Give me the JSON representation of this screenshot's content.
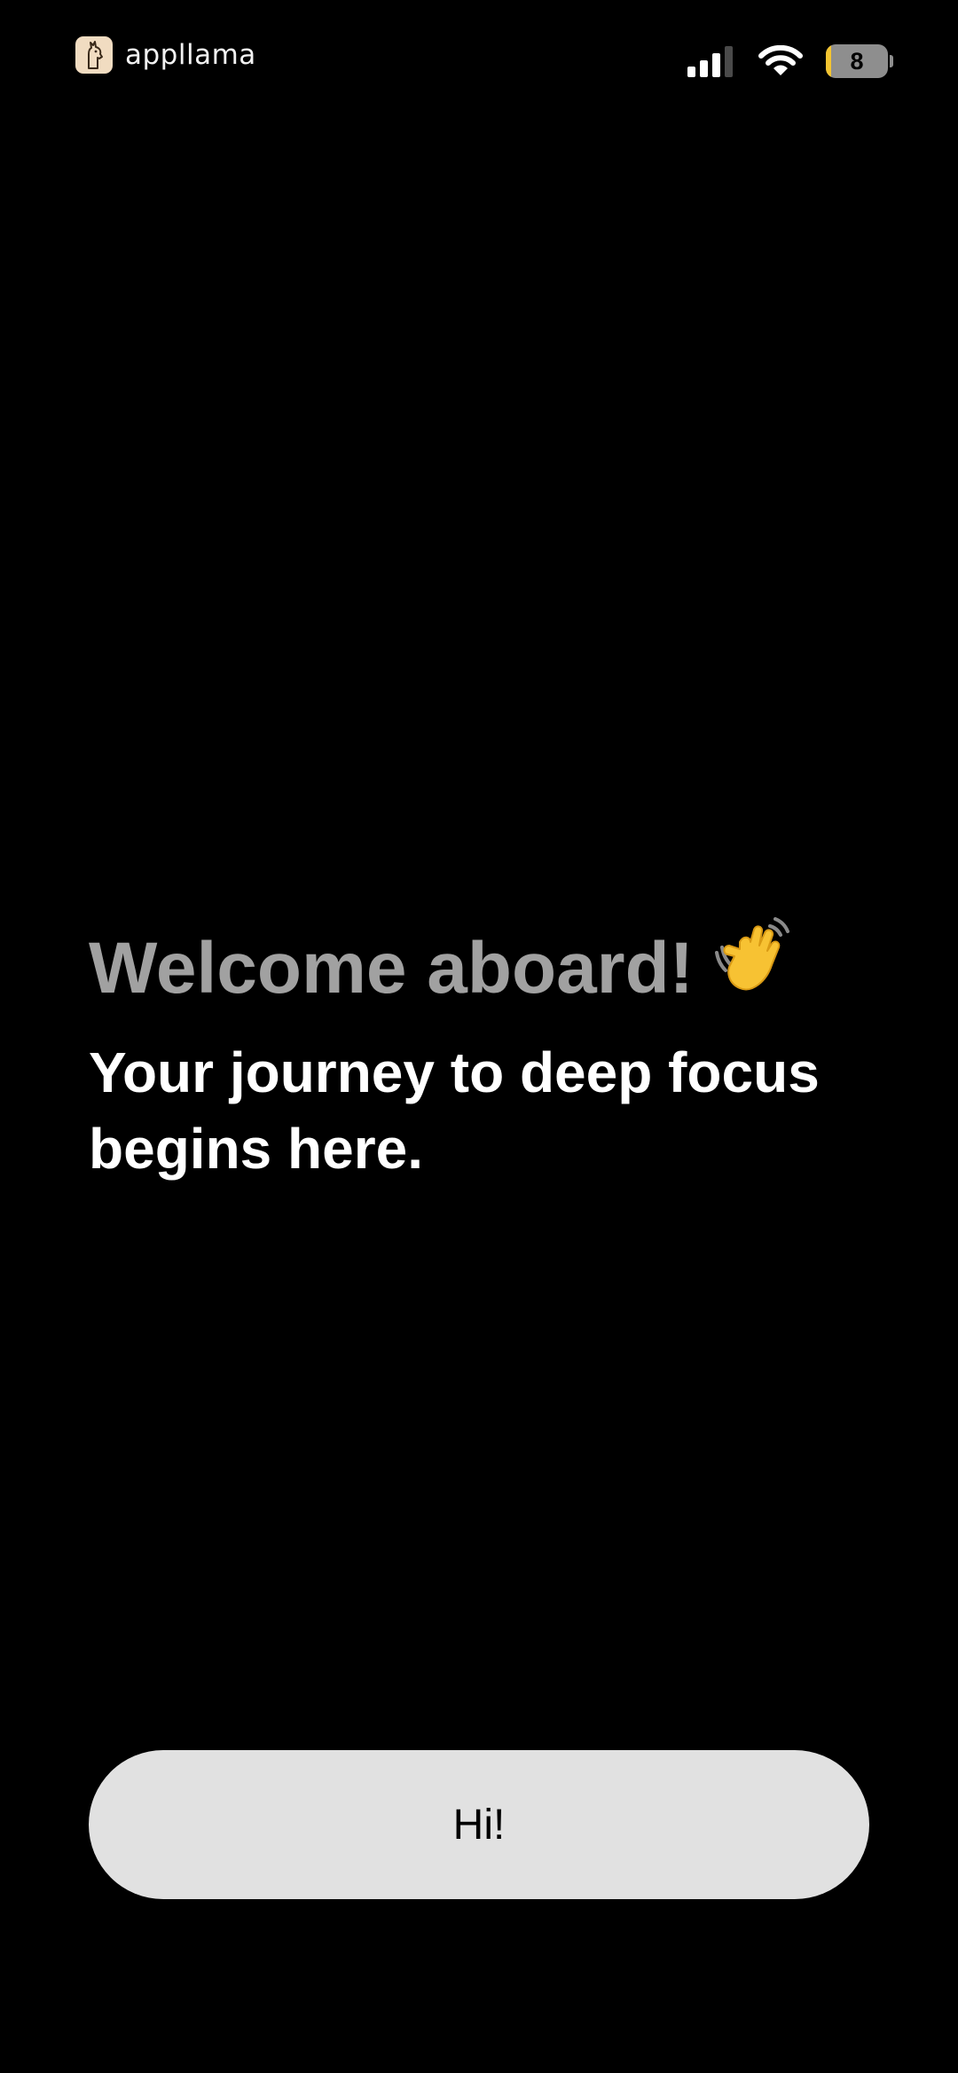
{
  "status_bar": {
    "brand_name": "appllama",
    "brand_icon": "llama-logo-icon",
    "signal_icon": "cellular-signal-icon",
    "wifi_icon": "wifi-icon",
    "battery_level": "8",
    "battery_fraction": 0.08,
    "battery_accent": "#f4c531"
  },
  "welcome": {
    "title": "Welcome aboard!",
    "title_icon": "waving-hand-icon",
    "subtitle": "Your journey to deep focus begins here."
  },
  "primary_action": {
    "label": "Hi!"
  },
  "colors": {
    "background": "#000000",
    "title": "#a1a1a1",
    "subtitle": "#ffffff",
    "button": "#e1e1e1"
  }
}
